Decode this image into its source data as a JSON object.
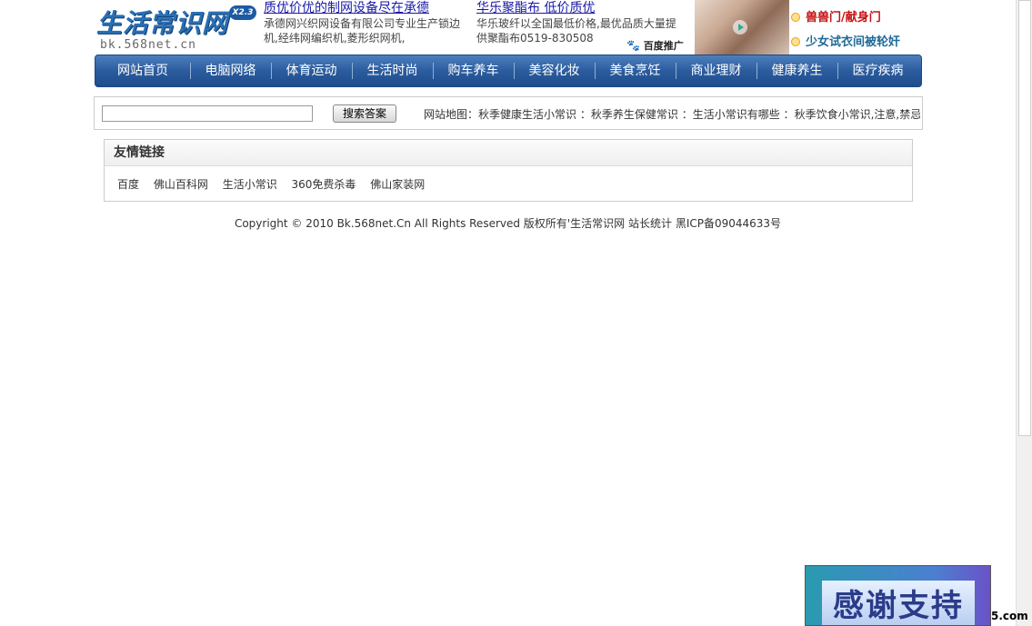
{
  "header": {
    "logo_text": "生活常识网",
    "logo_badge": "X2.3",
    "logo_domain": "bk.568net.cn",
    "ads": [
      {
        "title": "质优价优的制网设备尽在承德",
        "desc": "承德网兴织网设备有限公司专业生产锁边机,经纬网编织机,菱形织网机,"
      },
      {
        "title": "华乐聚酯布 低价质优",
        "desc": "华乐玻纤以全国最低价格,最优品质大量提供聚酯布0519-830508"
      }
    ],
    "baidu_tag": "百度推广",
    "side_links": [
      "兽兽门/献身门",
      "少女试衣间被轮奸"
    ]
  },
  "nav": {
    "items": [
      "网站首页",
      "电脑网络",
      "体育运动",
      "生活时尚",
      "购车养车",
      "美容化妆",
      "美食烹饪",
      "商业理财",
      "健康养生",
      "医疗疾病"
    ]
  },
  "search": {
    "input_value": "",
    "button_label": "搜索答案",
    "sitemap_label": "网站地图",
    "sitemap_links": [
      "秋季健康生活小常识",
      "秋季养生保健常识",
      "生活小常识有哪些",
      "秋季饮食小常识,注意,禁忌"
    ]
  },
  "friends": {
    "title": "友情链接",
    "links": [
      "百度",
      "佛山百科网",
      "生活小常识",
      "360免费杀毒",
      "佛山家装网"
    ]
  },
  "footer": {
    "copyright": "Copyright © 2010 Bk.568net.Cn All Rights Reserved 版权所有",
    "site_name": "生活常识网",
    "stats_link": "站长统计",
    "icp": "黑ICP备09044633号"
  },
  "float_ad": {
    "text": "感谢支持",
    "tail": "5.com"
  },
  "colors": {
    "nav_bg": "#2b5c9e",
    "ad_link": "#1a1aa6",
    "side_link_red": "#c41010",
    "side_link_blue": "#1e6a97"
  }
}
